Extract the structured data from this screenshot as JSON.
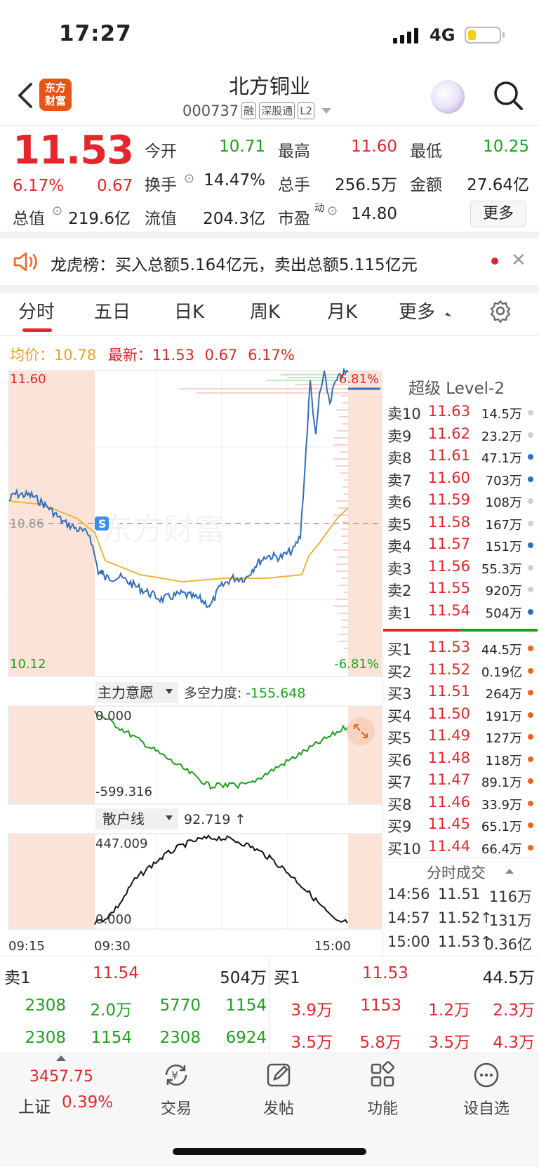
{
  "status": {
    "time": "17:27",
    "network": "4G"
  },
  "header": {
    "logo": "东方财富",
    "name": "北方铜业",
    "code": "000737",
    "tags": [
      "融",
      "深股通",
      "L2"
    ]
  },
  "quote": {
    "price": "11.53",
    "pct": "6.17%",
    "change": "0.67",
    "fields": [
      {
        "label": "今开",
        "value": "10.71",
        "color": "green"
      },
      {
        "label": "最高",
        "value": "11.60",
        "color": "red"
      },
      {
        "label": "最低",
        "value": "10.25",
        "color": "green"
      },
      {
        "label": "换手",
        "value": "14.47%",
        "color": "dark"
      },
      {
        "label": "总手",
        "value": "256.5万",
        "color": "dark"
      },
      {
        "label": "金额",
        "value": "27.64亿",
        "color": "dark"
      },
      {
        "label": "总值",
        "value": "219.6亿",
        "color": "dark"
      },
      {
        "label": "流值",
        "value": "204.3亿",
        "color": "dark"
      },
      {
        "label": "市盈",
        "sup": "动",
        "value": "14.80",
        "color": "dark"
      }
    ],
    "more": "更多"
  },
  "news": {
    "text": "龙虎榜：买入总额5.164亿元，卖出总额5.115亿元"
  },
  "tabs": [
    "分时",
    "五日",
    "日K",
    "周K",
    "月K",
    "更多"
  ],
  "summary": {
    "avg_label": "均价：",
    "avg": "10.78",
    "latest_label": "最新：",
    "latest": "11.53",
    "chg": "0.67",
    "pct": "6.17%"
  },
  "chart": {
    "max": "11.60",
    "min": "10.12",
    "prev_close": "10.86",
    "up_pct": "6.81%",
    "down_pct": "-6.81%",
    "flag": "S",
    "watermark": "东方财富",
    "times": [
      "09:15",
      "09:30",
      "15:00"
    ],
    "ind1": {
      "name": "主力意愿",
      "label": "多空力度:",
      "value": "-155.648",
      "top": "0.000",
      "bottom": "-599.316"
    },
    "ind2": {
      "name": "散户线",
      "value": "92.719 ↑",
      "top": "447.009",
      "bottom": "0.000"
    }
  },
  "level2": {
    "title": "超级 Level-2",
    "asks": [
      {
        "label": "卖10",
        "price": "11.63",
        "vol": "14.5万",
        "dot": "#cfcfcf"
      },
      {
        "label": "卖9",
        "price": "11.62",
        "vol": "23.2万",
        "dot": "#cfcfcf"
      },
      {
        "label": "卖8",
        "price": "11.61",
        "vol": "47.1万",
        "dot": "#2f6ebf"
      },
      {
        "label": "卖7",
        "price": "11.60",
        "vol": "703万",
        "dot": "#2f6ebf"
      },
      {
        "label": "卖6",
        "price": "11.59",
        "vol": "108万",
        "dot": "#cfcfcf"
      },
      {
        "label": "卖5",
        "price": "11.58",
        "vol": "167万",
        "dot": "#cfcfcf"
      },
      {
        "label": "卖4",
        "price": "11.57",
        "vol": "151万",
        "dot": "#2f6ebf"
      },
      {
        "label": "卖3",
        "price": "11.56",
        "vol": "55.3万",
        "dot": "#cfcfcf"
      },
      {
        "label": "卖2",
        "price": "11.55",
        "vol": "920万",
        "dot": "#cfcfcf"
      },
      {
        "label": "卖1",
        "price": "11.54",
        "vol": "504万",
        "dot": "#2f6ebf"
      }
    ],
    "bids": [
      {
        "label": "买1",
        "price": "11.53",
        "vol": "44.5万",
        "dot": "#e8661e"
      },
      {
        "label": "买2",
        "price": "11.52",
        "vol": "0.19亿",
        "dot": "#e8661e"
      },
      {
        "label": "买3",
        "price": "11.51",
        "vol": "264万",
        "dot": "#e8661e"
      },
      {
        "label": "买4",
        "price": "11.50",
        "vol": "191万",
        "dot": "#e8661e"
      },
      {
        "label": "买5",
        "price": "11.49",
        "vol": "127万",
        "dot": "#e8661e"
      },
      {
        "label": "买6",
        "price": "11.48",
        "vol": "118万",
        "dot": "#e8661e"
      },
      {
        "label": "买7",
        "price": "11.47",
        "vol": "89.1万",
        "dot": "#e8661e"
      },
      {
        "label": "买8",
        "price": "11.46",
        "vol": "33.9万",
        "dot": "#e8661e"
      },
      {
        "label": "买9",
        "price": "11.45",
        "vol": "65.1万",
        "dot": "#e8661e"
      },
      {
        "label": "买10",
        "price": "11.44",
        "vol": "66.4万",
        "dot": "#e8661e"
      }
    ],
    "ticks_title": "分时成交",
    "ticks": [
      {
        "time": "14:56",
        "price": "11.51",
        "vol": "116万",
        "vcolor": "red"
      },
      {
        "time": "14:57",
        "price": "11.52↑",
        "vol": "131万",
        "vcolor": "red"
      },
      {
        "time": "15:00",
        "price": "11.53↑",
        "vol": "0.36亿",
        "vcolor": "green"
      }
    ]
  },
  "bottom_book": {
    "sell_label": "卖1",
    "sell_price": "11.54",
    "sell_vol": "504万",
    "buy_label": "买1",
    "buy_price": "11.53",
    "buy_vol": "44.5万",
    "sell_row1": [
      "2308",
      "2.0万",
      "5770",
      "1154"
    ],
    "sell_row2": [
      "2308",
      "1154",
      "2308",
      "6924"
    ],
    "buy_row1": [
      "3.9万",
      "1153",
      "1.2万",
      "2.3万"
    ],
    "buy_row2": [
      "3.5万",
      "5.8万",
      "3.5万",
      "4.3万"
    ]
  },
  "nav": {
    "index_value": "3457.75",
    "index_name": "上证",
    "index_pct": "0.39%",
    "items": [
      "交易",
      "发帖",
      "功能",
      "设自选"
    ]
  }
}
